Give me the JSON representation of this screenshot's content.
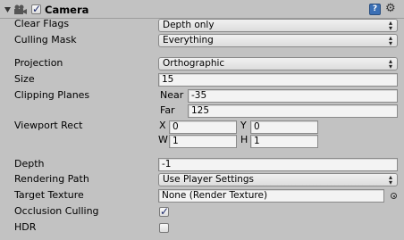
{
  "component": {
    "title": "Camera",
    "enabled": true,
    "icons": [
      "foldout-arrow-icon",
      "camera-icon",
      "help-book-icon",
      "gear-icon"
    ]
  },
  "fields": {
    "clear_flags": {
      "label": "Clear Flags",
      "value": "Depth only"
    },
    "culling_mask": {
      "label": "Culling Mask",
      "value": "Everything"
    },
    "projection": {
      "label": "Projection",
      "value": "Orthographic"
    },
    "size": {
      "label": "Size",
      "value": "15"
    },
    "clipping_planes": {
      "label": "Clipping Planes",
      "near_label": "Near",
      "near": "-35",
      "far_label": "Far",
      "far": "125"
    },
    "viewport_rect": {
      "label": "Viewport Rect",
      "x_label": "X",
      "x": "0",
      "y_label": "Y",
      "y": "0",
      "w_label": "W",
      "w": "1",
      "h_label": "H",
      "h": "1"
    },
    "depth": {
      "label": "Depth",
      "value": "-1"
    },
    "rendering_path": {
      "label": "Rendering Path",
      "value": "Use Player Settings"
    },
    "target_texture": {
      "label": "Target Texture",
      "value": "None (Render Texture)"
    },
    "occlusion_culling": {
      "label": "Occlusion Culling",
      "checked": true
    },
    "hdr": {
      "label": "HDR",
      "checked": false
    }
  },
  "colors": {
    "panel_bg": "#c2c2c2",
    "field_bg": "#f3f3f3",
    "check": "#1d2a6b"
  }
}
